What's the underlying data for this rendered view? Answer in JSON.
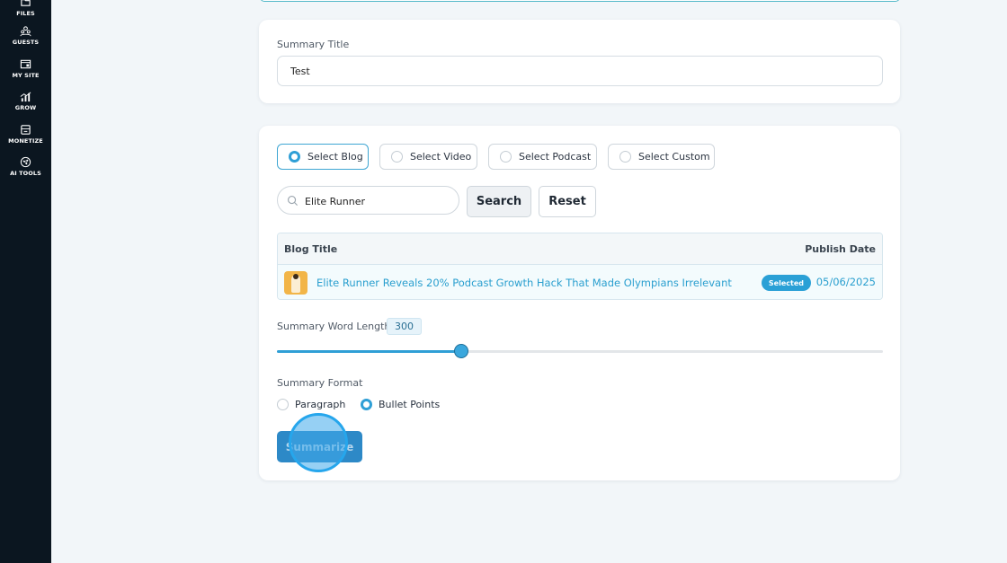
{
  "sidebar": {
    "items": [
      {
        "label": "FILES",
        "icon": "folder-icon"
      },
      {
        "label": "GUESTS",
        "icon": "people-icon"
      },
      {
        "label": "MY SITE",
        "icon": "window-icon"
      },
      {
        "label": "GROW",
        "icon": "bar-chart-icon"
      },
      {
        "label": "MONETIZE",
        "icon": "box-icon"
      },
      {
        "label": "AI TOOLS",
        "icon": "network-icon"
      }
    ]
  },
  "summary_title": {
    "label": "Summary Title",
    "value": "Test"
  },
  "content_types": [
    {
      "label": "Select Blog",
      "selected": true
    },
    {
      "label": "Select Video",
      "selected": false
    },
    {
      "label": "Select Podcast",
      "selected": false
    },
    {
      "label": "Select Custom",
      "selected": false
    }
  ],
  "search": {
    "value": "Elite Runner",
    "search_label": "Search",
    "reset_label": "Reset"
  },
  "table": {
    "columns": [
      "Blog Title",
      "Publish Date"
    ],
    "rows": [
      {
        "title": "Elite Runner Reveals 20% Podcast Growth Hack That Made Olympians Irrelevant",
        "badge": "Selected",
        "date": "05/06/2025"
      }
    ]
  },
  "word_length": {
    "label": "Summary Word Length",
    "value": "300",
    "fraction": 0.304
  },
  "format": {
    "label": "Summary Format",
    "options": [
      {
        "label": "Paragraph",
        "selected": false
      },
      {
        "label": "Bullet Points",
        "selected": true
      }
    ]
  },
  "summarize_label": "Summarize",
  "colors": {
    "accent": "#2f9fd6",
    "sidebar": "#0b1620",
    "link": "#2a9fcf"
  }
}
